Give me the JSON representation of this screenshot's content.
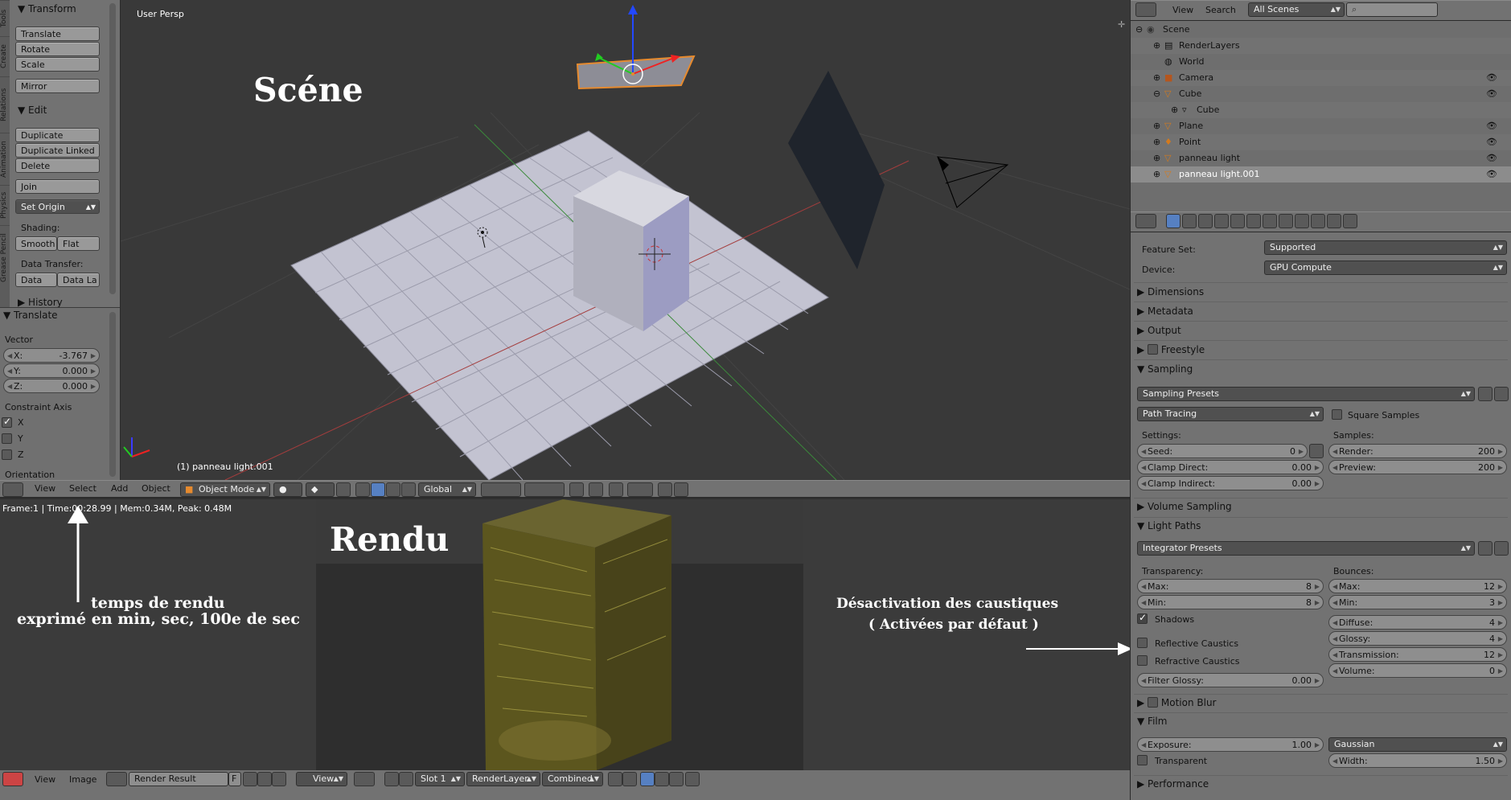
{
  "toolshelf": {
    "tabs": [
      "Tools",
      "Create",
      "Relations",
      "Animation",
      "Physics",
      "Grease Pencil"
    ],
    "transform": {
      "title": "Transform",
      "buttons": [
        "Translate",
        "Rotate",
        "Scale"
      ],
      "mirror": "Mirror"
    },
    "edit": {
      "title": "Edit",
      "buttons": [
        "Duplicate",
        "Duplicate Linked",
        "Delete"
      ],
      "join": "Join",
      "set_origin": "Set Origin",
      "shading_label": "Shading:",
      "smooth": "Smooth",
      "flat": "Flat",
      "data_transfer_label": "Data Transfer:",
      "data": "Data",
      "data_la": "Data La"
    },
    "history": "History"
  },
  "operator": {
    "title": "Translate",
    "vector_label": "Vector",
    "x": {
      "k": "X:",
      "v": "-3.767"
    },
    "y": {
      "k": "Y:",
      "v": "0.000"
    },
    "z": {
      "k": "Z:",
      "v": "0.000"
    },
    "constraint_label": "Constraint Axis",
    "axes": [
      "X",
      "Y",
      "Z"
    ],
    "axes_checked": [
      true,
      false,
      false
    ],
    "orientation": "Orientation"
  },
  "viewport": {
    "view_name": "User Persp",
    "object_label": "(1) panneau light.001",
    "annotation": "Scéne",
    "header": {
      "menus": [
        "View",
        "Select",
        "Add",
        "Object"
      ],
      "mode": "Object Mode",
      "orientation": "Global"
    }
  },
  "render": {
    "status": "Frame:1 | Time:00:28.99 | Mem:0.34M, Peak: 0.48M",
    "annotation_title": "Rendu",
    "annotation_time_1": "temps de rendu",
    "annotation_time_2": "exprimé en min, sec, 100e de sec",
    "annotation_caustics_1": "Désactivation des caustiques",
    "annotation_caustics_2": "( Activées par défaut )",
    "header": {
      "menus": [
        "View",
        "Image"
      ],
      "image": "Render Result",
      "f": "F",
      "view": "View",
      "slot": "Slot 1",
      "layer": "RenderLayer",
      "pass": "Combined"
    }
  },
  "outliner": {
    "menus": [
      "View",
      "Search"
    ],
    "scenes": "All Scenes",
    "rows": [
      {
        "label": "Scene",
        "indent": 0
      },
      {
        "label": "RenderLayers",
        "indent": 1
      },
      {
        "label": "World",
        "indent": 1
      },
      {
        "label": "Camera",
        "indent": 1
      },
      {
        "label": "Cube",
        "indent": 1
      },
      {
        "label": "Cube",
        "indent": 2
      },
      {
        "label": "Plane",
        "indent": 1
      },
      {
        "label": "Point",
        "indent": 1
      },
      {
        "label": "panneau light",
        "indent": 1
      },
      {
        "label": "panneau light.001",
        "indent": 1
      }
    ]
  },
  "properties": {
    "feature_set_label": "Feature Set:",
    "feature_set": "Supported",
    "device_label": "Device:",
    "device": "GPU Compute",
    "sections_top": [
      "Dimensions",
      "Metadata",
      "Output",
      "Freestyle"
    ],
    "sampling": "Sampling",
    "sampling_presets": "Sampling Presets",
    "path_tracing": "Path Tracing",
    "square_samples": "Square Samples",
    "settings_label": "Settings:",
    "samples_label": "Samples:",
    "seed": {
      "k": "Seed:",
      "v": "0"
    },
    "clamp_direct": {
      "k": "Clamp Direct:",
      "v": "0.00"
    },
    "clamp_indirect": {
      "k": "Clamp Indirect:",
      "v": "0.00"
    },
    "render_s": {
      "k": "Render:",
      "v": "200"
    },
    "preview_s": {
      "k": "Preview:",
      "v": "200"
    },
    "volume_sampling": "Volume Sampling",
    "light_paths": "Light Paths",
    "integrator_presets": "Integrator Presets",
    "transparency_label": "Transparency:",
    "bounces_label": "Bounces:",
    "t_max": {
      "k": "Max:",
      "v": "8"
    },
    "t_min": {
      "k": "Min:",
      "v": "8"
    },
    "b_max": {
      "k": "Max:",
      "v": "12"
    },
    "b_min": {
      "k": "Min:",
      "v": "3"
    },
    "diffuse": {
      "k": "Diffuse:",
      "v": "4"
    },
    "glossy": {
      "k": "Glossy:",
      "v": "4"
    },
    "transmission": {
      "k": "Transmission:",
      "v": "12"
    },
    "volume": {
      "k": "Volume:",
      "v": "0"
    },
    "shadows": "Shadows",
    "reflective": "Reflective Caustics",
    "refractive": "Refractive Caustics",
    "filter_glossy": {
      "k": "Filter Glossy:",
      "v": "0.00"
    },
    "motion_blur": "Motion Blur",
    "film": "Film",
    "exposure": {
      "k": "Exposure:",
      "v": "1.00"
    },
    "filter": "Gaussian",
    "transparent": "Transparent",
    "width": {
      "k": "Width:",
      "v": "1.50"
    },
    "performance": "Performance"
  }
}
